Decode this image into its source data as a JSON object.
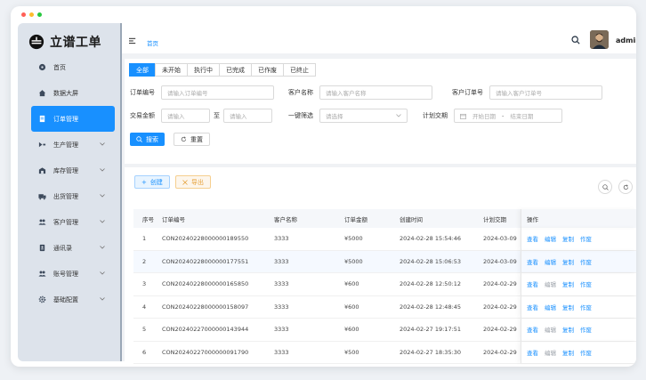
{
  "app": {
    "name": "立谱工单"
  },
  "window_dots": [
    "#ff5f57",
    "#febc2e",
    "#28c840"
  ],
  "sidebar": {
    "items": [
      {
        "label": "首页",
        "icon": "dashboard-icon",
        "has_arrow": false,
        "active": false
      },
      {
        "label": "数据大屏",
        "icon": "home-icon",
        "has_arrow": false,
        "active": false
      },
      {
        "label": "订单管理",
        "icon": "document-icon",
        "has_arrow": false,
        "active": true
      },
      {
        "label": "生产管理",
        "icon": "flow-icon",
        "has_arrow": true,
        "active": false
      },
      {
        "label": "库存管理",
        "icon": "warehouse-icon",
        "has_arrow": true,
        "active": false
      },
      {
        "label": "出货管理",
        "icon": "truck-icon",
        "has_arrow": true,
        "active": false
      },
      {
        "label": "客户管理",
        "icon": "users-icon",
        "has_arrow": true,
        "active": false
      },
      {
        "label": "通讯录",
        "icon": "contacts-icon",
        "has_arrow": true,
        "active": false
      },
      {
        "label": "账号管理",
        "icon": "account-icon",
        "has_arrow": true,
        "active": false
      },
      {
        "label": "基础配置",
        "icon": "gear-icon",
        "has_arrow": true,
        "active": false
      }
    ]
  },
  "header": {
    "breadcrumb": "首页",
    "username": "admin"
  },
  "filters": {
    "tabs": [
      {
        "label": "全部",
        "active": true
      },
      {
        "label": "未开始",
        "active": false
      },
      {
        "label": "执行中",
        "active": false
      },
      {
        "label": "已完成",
        "active": false
      },
      {
        "label": "已作废",
        "active": false
      },
      {
        "label": "已终止",
        "active": false
      }
    ],
    "order_no_label": "订单编号",
    "order_no_placeholder": "请输入订单编号",
    "customer_label": "客户名称",
    "customer_placeholder": "请输入客户名称",
    "customer_order_label": "客户订单号",
    "customer_order_placeholder": "请输入客户订单号",
    "amount_label": "交易金额",
    "amount_min_placeholder": "请输入",
    "amount_sep": "至",
    "amount_max_placeholder": "请输入",
    "quick_label": "一键筛选",
    "quick_placeholder": "请选择",
    "delivery_label": "计划交期",
    "date_start": "开始日期",
    "date_sep": "-",
    "date_end": "结束日期",
    "search_btn": "搜索",
    "reset_btn": "重置"
  },
  "toolbar": {
    "create": "创建",
    "export": "导出"
  },
  "table": {
    "headers": [
      "序号",
      "订单编号",
      "客户名称",
      "订单金额",
      "创建时间",
      "计划交期",
      "操作"
    ],
    "rows": [
      {
        "idx": "1",
        "order_no": "CON20240228000000189550",
        "customer": "3333",
        "amount": "¥5000",
        "created": "2024-02-28 15:54:46",
        "delivery": "2024-03-09",
        "edit_enabled": true
      },
      {
        "idx": "2",
        "order_no": "CON20240228000000177551",
        "customer": "3333",
        "amount": "¥5000",
        "created": "2024-02-28 15:06:53",
        "delivery": "2024-03-09",
        "edit_enabled": true
      },
      {
        "idx": "3",
        "order_no": "CON20240228000000165850",
        "customer": "3333",
        "amount": "¥600",
        "created": "2024-02-28 12:50:12",
        "delivery": "2024-02-29",
        "edit_enabled": false
      },
      {
        "idx": "4",
        "order_no": "CON20240228000000158097",
        "customer": "3333",
        "amount": "¥600",
        "created": "2024-02-28 12:48:45",
        "delivery": "2024-02-29",
        "edit_enabled": true
      },
      {
        "idx": "5",
        "order_no": "CON20240227000000143944",
        "customer": "3333",
        "amount": "¥600",
        "created": "2024-02-27 19:17:51",
        "delivery": "2024-02-29",
        "edit_enabled": false
      },
      {
        "idx": "6",
        "order_no": "CON20240227000000091790",
        "customer": "3333",
        "amount": "¥500",
        "created": "2024-02-27 18:35:30",
        "delivery": "2024-02-29",
        "edit_enabled": false
      }
    ],
    "ops": {
      "view": "查看",
      "edit": "编辑",
      "copy": "复制",
      "void": "作废"
    }
  },
  "colors": {
    "primary": "#1890ff",
    "sidebar_bg": "#dde3eb",
    "export": "#e6a23c"
  }
}
